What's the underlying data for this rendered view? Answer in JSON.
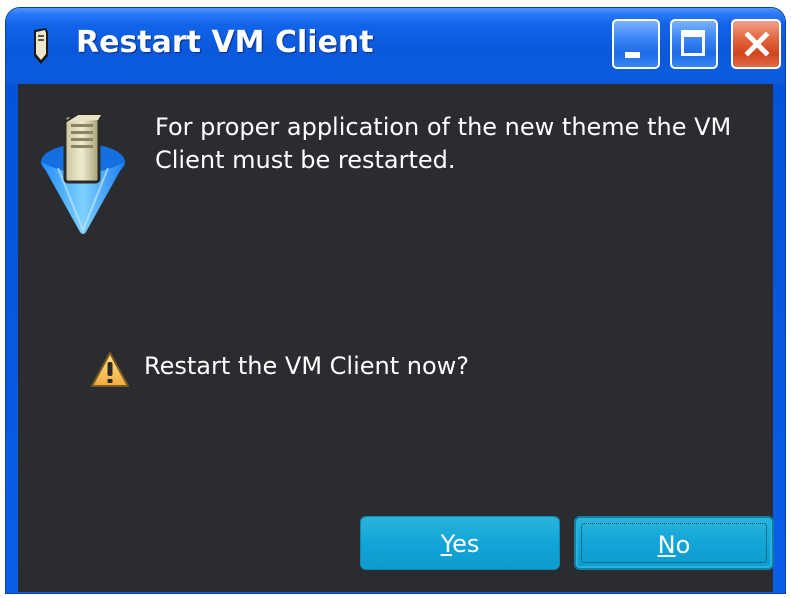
{
  "window": {
    "title": "Restart VM Client",
    "controls": {
      "minimize": "minimize-icon",
      "maximize": "maximize-icon",
      "close": "close-icon"
    }
  },
  "dialog": {
    "message": "For proper application of the new theme the VM Client must be restarted.",
    "question": "Restart the VM Client now?",
    "icons": {
      "app": "vm-client-server-icon",
      "question": "warning-icon"
    }
  },
  "buttons": {
    "yes": {
      "mnemonic": "Y",
      "rest": "es"
    },
    "no": {
      "mnemonic": "N",
      "rest": "o"
    }
  },
  "colors": {
    "title_bar": "#0a58dc",
    "close_button": "#d2451c",
    "content_background": "#2a2c30",
    "button": "#13a6d8",
    "text": "#ffffff"
  }
}
